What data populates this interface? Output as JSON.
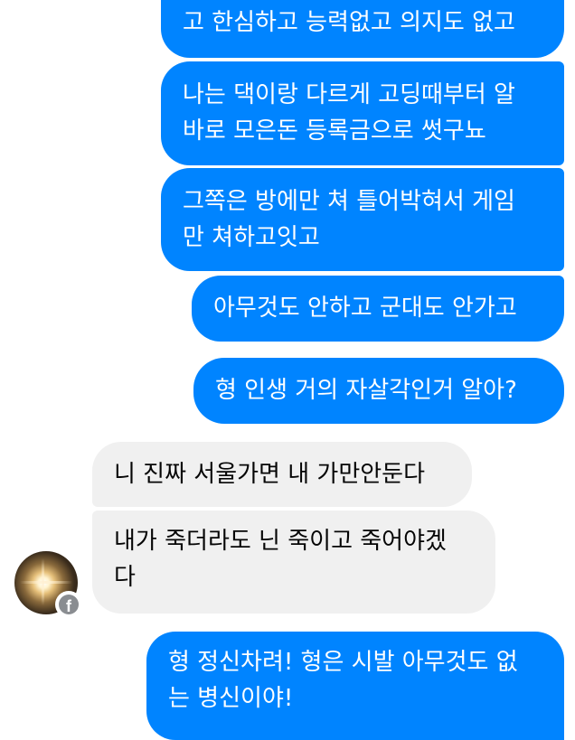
{
  "messages": [
    {
      "side": "sent",
      "lines": [
        "고 한심하고 능력없고 의지도 없고"
      ]
    },
    {
      "side": "sent",
      "lines": [
        "나는 댁이랑 다르게 고딩때부터 알",
        "바로 모은돈 등록금으로 썻구뇨"
      ]
    },
    {
      "side": "sent",
      "lines": [
        "그쪽은 방에만 쳐 틀어박혀서 게임",
        "만 쳐하고잇고"
      ]
    },
    {
      "side": "sent",
      "lines": [
        "아무것도 안하고 군대도 안가고"
      ]
    },
    {
      "side": "sent",
      "lines": [
        "형 인생 거의 자살각인거 알아?"
      ]
    },
    {
      "side": "received",
      "lines": [
        "니 진짜 서울가면 내 가만안둔다"
      ]
    },
    {
      "side": "received",
      "lines": [
        "내가 죽더라도 닌 죽이고 죽어야겠",
        "다"
      ]
    },
    {
      "side": "sent",
      "lines": [
        "형 정신차려! 형은 시발 아무것도 없",
        "는 병신이야!"
      ]
    }
  ],
  "contact": {
    "avatar_icon": "contact-avatar",
    "badge_icon": "facebook-icon",
    "badge_glyph": "f"
  },
  "colors": {
    "sent_bubble": "#0084ff",
    "received_bubble": "#f0f0f0",
    "sent_text": "#ffffff",
    "received_text": "#050505"
  }
}
